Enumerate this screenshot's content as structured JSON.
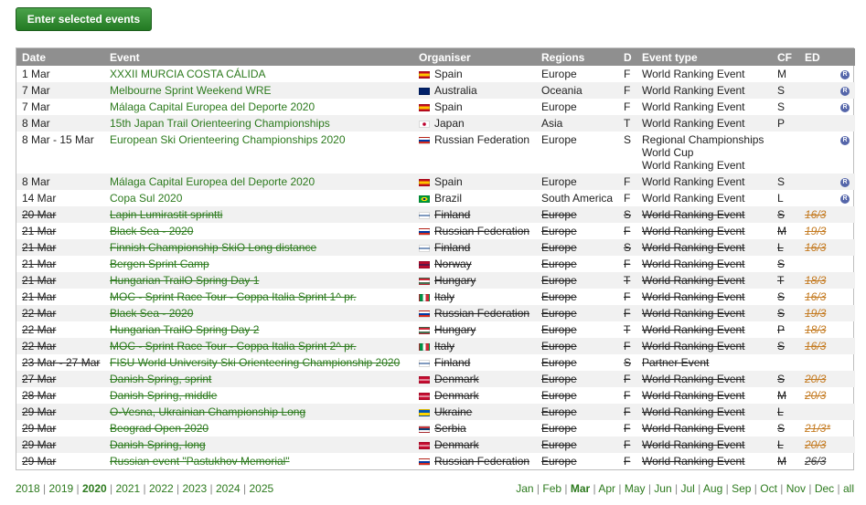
{
  "button": {
    "label": "Enter selected events"
  },
  "headers": [
    "Date",
    "Event",
    "Organiser",
    "Regions",
    "D",
    "Event type",
    "CF",
    "ED",
    ""
  ],
  "rows": [
    {
      "date": "1 Mar",
      "event": "XXXII MURCIA COSTA CÁLIDA",
      "flag": "es",
      "org": "Spain",
      "region": "Europe",
      "d": "F",
      "type": [
        "World Ranking Event"
      ],
      "cf": "M",
      "ed": "",
      "r": true,
      "cx": false
    },
    {
      "date": "7 Mar",
      "event": "Melbourne Sprint Weekend WRE",
      "flag": "au",
      "org": "Australia",
      "region": "Oceania",
      "d": "F",
      "type": [
        "World Ranking Event"
      ],
      "cf": "S",
      "ed": "",
      "r": true,
      "cx": false
    },
    {
      "date": "7 Mar",
      "event": "Málaga Capital Europea del Deporte 2020",
      "flag": "es",
      "org": "Spain",
      "region": "Europe",
      "d": "F",
      "type": [
        "World Ranking Event"
      ],
      "cf": "S",
      "ed": "",
      "r": true,
      "cx": false
    },
    {
      "date": "8 Mar",
      "event": "15th Japan Trail Orienteering Championships",
      "flag": "jp",
      "org": "Japan",
      "region": "Asia",
      "d": "T",
      "type": [
        "World Ranking Event"
      ],
      "cf": "P",
      "ed": "",
      "r": false,
      "cx": false
    },
    {
      "date": "8 Mar - 15 Mar",
      "event": "European Ski Orienteering Championships 2020",
      "flag": "ru",
      "org": "Russian Federation",
      "region": "Europe",
      "d": "S",
      "type": [
        "Regional Championships",
        "World Cup",
        "World Ranking Event"
      ],
      "cf": "",
      "ed": "",
      "r": true,
      "cx": false
    },
    {
      "date": "8 Mar",
      "event": "Málaga Capital Europea del Deporte 2020",
      "flag": "es",
      "org": "Spain",
      "region": "Europe",
      "d": "F",
      "type": [
        "World Ranking Event"
      ],
      "cf": "S",
      "ed": "",
      "r": true,
      "cx": false
    },
    {
      "date": "14 Mar",
      "event": "Copa Sul 2020",
      "flag": "br",
      "org": "Brazil",
      "region": "South America",
      "d": "F",
      "type": [
        "World Ranking Event"
      ],
      "cf": "L",
      "ed": "",
      "r": true,
      "cx": false
    },
    {
      "date": "20 Mar",
      "event": "Lapin Lumirastit sprintti",
      "flag": "fi",
      "org": "Finland",
      "region": "Europe",
      "d": "S",
      "type": [
        "World Ranking Event"
      ],
      "cf": "S",
      "ed": "16/3",
      "r": false,
      "cx": true
    },
    {
      "date": "21 Mar",
      "event": "Black Sea - 2020",
      "flag": "ru",
      "org": "Russian Federation",
      "region": "Europe",
      "d": "F",
      "type": [
        "World Ranking Event"
      ],
      "cf": "M",
      "ed": "19/3",
      "r": false,
      "cx": true
    },
    {
      "date": "21 Mar",
      "event": "Finnish Championship SkiO Long distance",
      "flag": "fi",
      "org": "Finland",
      "region": "Europe",
      "d": "S",
      "type": [
        "World Ranking Event"
      ],
      "cf": "L",
      "ed": "16/3",
      "r": false,
      "cx": true
    },
    {
      "date": "21 Mar",
      "event": "Bergen Sprint Camp",
      "flag": "no",
      "org": "Norway",
      "region": "Europe",
      "d": "F",
      "type": [
        "World Ranking Event"
      ],
      "cf": "S",
      "ed": "",
      "r": false,
      "cx": true
    },
    {
      "date": "21 Mar",
      "event": "Hungarian TrailO Spring Day 1",
      "flag": "hu",
      "org": "Hungary",
      "region": "Europe",
      "d": "T",
      "type": [
        "World Ranking Event"
      ],
      "cf": "T",
      "ed": "18/3",
      "r": false,
      "cx": true
    },
    {
      "date": "21 Mar",
      "event": "MOC - Sprint Race Tour - Coppa Italia Sprint 1^ pr.",
      "flag": "it",
      "org": "Italy",
      "region": "Europe",
      "d": "F",
      "type": [
        "World Ranking Event"
      ],
      "cf": "S",
      "ed": "16/3",
      "r": false,
      "cx": true
    },
    {
      "date": "22 Mar",
      "event": "Black Sea - 2020",
      "flag": "ru",
      "org": "Russian Federation",
      "region": "Europe",
      "d": "F",
      "type": [
        "World Ranking Event"
      ],
      "cf": "S",
      "ed": "19/3",
      "r": false,
      "cx": true
    },
    {
      "date": "22 Mar",
      "event": "Hungarian TrailO Spring Day 2",
      "flag": "hu",
      "org": "Hungary",
      "region": "Europe",
      "d": "T",
      "type": [
        "World Ranking Event"
      ],
      "cf": "P",
      "ed": "18/3",
      "r": false,
      "cx": true
    },
    {
      "date": "22 Mar",
      "event": "MOC - Sprint Race Tour - Coppa Italia Sprint 2^ pr.",
      "flag": "it",
      "org": "Italy",
      "region": "Europe",
      "d": "F",
      "type": [
        "World Ranking Event"
      ],
      "cf": "S",
      "ed": "16/3",
      "r": false,
      "cx": true
    },
    {
      "date": "23 Mar - 27 Mar",
      "event": "FISU World University Ski Orienteering Championship 2020",
      "flag": "fi",
      "org": "Finland",
      "region": "Europe",
      "d": "S",
      "type": [
        "Partner Event"
      ],
      "cf": "",
      "ed": "",
      "r": false,
      "cx": true
    },
    {
      "date": "27 Mar",
      "event": "Danish Spring, sprint",
      "flag": "dk",
      "org": "Denmark",
      "region": "Europe",
      "d": "F",
      "type": [
        "World Ranking Event"
      ],
      "cf": "S",
      "ed": "20/3",
      "r": false,
      "cx": true
    },
    {
      "date": "28 Mar",
      "event": "Danish Spring, middle",
      "flag": "dk",
      "org": "Denmark",
      "region": "Europe",
      "d": "F",
      "type": [
        "World Ranking Event"
      ],
      "cf": "M",
      "ed": "20/3",
      "r": false,
      "cx": true
    },
    {
      "date": "29 Mar",
      "event": "O-Vesna, Ukrainian Championship Long",
      "flag": "ua",
      "org": "Ukraine",
      "region": "Europe",
      "d": "F",
      "type": [
        "World Ranking Event"
      ],
      "cf": "L",
      "ed": "",
      "r": false,
      "cx": true
    },
    {
      "date": "29 Mar",
      "event": "Beograd Open 2020",
      "flag": "rs",
      "org": "Serbia",
      "region": "Europe",
      "d": "F",
      "type": [
        "World Ranking Event"
      ],
      "cf": "S",
      "ed": "21/3*",
      "r": false,
      "cx": true
    },
    {
      "date": "29 Mar",
      "event": "Danish Spring, long",
      "flag": "dk",
      "org": "Denmark",
      "region": "Europe",
      "d": "F",
      "type": [
        "World Ranking Event"
      ],
      "cf": "L",
      "ed": "20/3",
      "r": false,
      "cx": true
    },
    {
      "date": "29 Mar",
      "event": "Russian event \"Pastukhov Memorial\"",
      "flag": "ru",
      "org": "Russian Federation",
      "region": "Europe",
      "d": "F",
      "type": [
        "World Ranking Event"
      ],
      "cf": "M",
      "ed": "26/3",
      "edok": true,
      "r": false,
      "cx": true
    }
  ],
  "years": [
    "2018",
    "2019",
    "2020",
    "2021",
    "2022",
    "2023",
    "2024",
    "2025"
  ],
  "current_year": "2020",
  "months": [
    "Jan",
    "Feb",
    "Mar",
    "Apr",
    "May",
    "Jun",
    "Jul",
    "Aug",
    "Sep",
    "Oct",
    "Nov",
    "Dec",
    "all"
  ],
  "current_month": "Mar",
  "colors": {
    "accent": "#2c7a1d",
    "header_bg": "#8f8f8f",
    "button": "#2e8a2e",
    "deadline": "#c47a20"
  }
}
